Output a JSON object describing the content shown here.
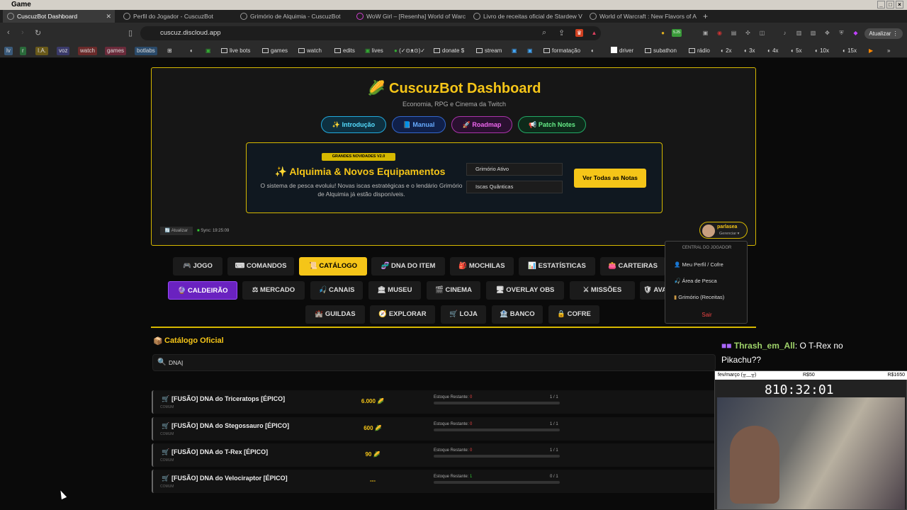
{
  "window": {
    "title": "Game"
  },
  "tabs": [
    {
      "label": "CuscuzBot Dashboard",
      "active": true
    },
    {
      "label": "Perfil do Jogador - CuscuzBot"
    },
    {
      "label": "Grimório de Alquimia - CuscuzBot"
    },
    {
      "label": "WoW Girl – [Resenha] World of Warc"
    },
    {
      "label": "Livro de receitas oficial de Stardew V"
    },
    {
      "label": "World of Warcraft : New Flavors of A"
    }
  ],
  "address": {
    "url": "cuscuz.discloud.app",
    "update_label": "Atualizar",
    "badge": "5.25"
  },
  "bookmarks": [
    "lv",
    "r",
    "I.A.",
    "voz",
    "watch",
    "games",
    "botlabs",
    "live bots",
    "games",
    "watch",
    "edits",
    "lives",
    "(✓⊙ᴥ⊙)✓",
    "donate $",
    "stream",
    "formatação",
    "driver",
    "subathon",
    "rádio",
    "2x",
    "3x",
    "4x",
    "5x",
    "10x",
    "15x"
  ],
  "header": {
    "title": "CuscuzBot Dashboard",
    "subtitle": "Economia, RPG e Cinema da Twitch",
    "buttons": [
      "✨ Introdução",
      "📘 Manual",
      "🚀 Roadmap",
      "📢 Patch Notes"
    ]
  },
  "promo": {
    "badge": "GRANDES NOVIDADES V2.0",
    "title": "✨ Alquimia & Novos Equipamentos",
    "desc": "O sistema de pesca evoluiu! Novas iscas estratégicas e o lendário Grimório de Alquimia já estão disponíveis.",
    "chips": [
      "Grimório Ativo",
      "Iscas Quânticas"
    ],
    "cta": "Ver Todas as Notas"
  },
  "toolbar": {
    "refresh": "Atualizar",
    "sync": "Sync: 19:25:09"
  },
  "user": {
    "name": "parlasea",
    "manage": "Gerenciar ▾"
  },
  "dropdown": {
    "header": "CENTRAL DO JOGADOR",
    "items": [
      "Meu Perfil / Cofre",
      "Área de Pesca",
      "Grimório (Receitas)"
    ],
    "exit": "Sair"
  },
  "nav": {
    "row1": [
      "🎮 JOGO",
      "⌨ COMANDOS",
      "📜 CATÁLOGO",
      "🧬 DNA DO ITEM",
      "🎒 MOCHILAS",
      "📊 ESTATÍSTICAS",
      "👛 CARTEIRAS"
    ],
    "row2": [
      "🔮 CALDEIRÃO",
      "⚖ MERCADO",
      "🎣 CANAIS",
      "🏛 MUSEU",
      "🎬 CINEMA",
      "🖥 OVERLAY OBS",
      "⚔ MISSÕES",
      "🛡 AVA"
    ],
    "row3": [
      "🏰 GUILDAS",
      "🧭 EXPLORAR",
      "🛒 LOJA",
      "🏦 BANCO",
      "🔒 COFRE"
    ]
  },
  "catalog": {
    "title": "Catálogo Oficial",
    "search_value": "DNA",
    "rows": [
      {
        "name": "[FUSÃO] DNA do Triceratops [ÉPICO]",
        "rarity": "COMUM",
        "price": "6.000",
        "stock_label": "Estoque Restante:",
        "stock": "0",
        "count": "1 / 1"
      },
      {
        "name": "[FUSÃO] DNA do Stegossauro [ÉPICO]",
        "rarity": "COMUM",
        "price": "600",
        "stock_label": "Estoque Restante:",
        "stock": "0",
        "count": "1 / 1"
      },
      {
        "name": "[FUSÃO] DNA do T-Rex [ÉPICO]",
        "rarity": "COMUM",
        "price": "90",
        "stock_label": "Estoque Restante:",
        "stock": "0",
        "count": "1 / 1"
      },
      {
        "name": "[FUSÃO] DNA do Velociraptor [ÉPICO]",
        "rarity": "COMUM",
        "price": "---",
        "stock_label": "Estoque Restante:",
        "stock": "1",
        "count": "0 / 1"
      }
    ]
  },
  "chat": {
    "user": "Thrash_em_All",
    "message": ": O T-Rex no Pikachu??"
  },
  "stream": {
    "header_left": "fev/março (╥﹏╥)",
    "goal1": "R$50",
    "goal2": "R$1650",
    "timer": "810:32:01"
  }
}
